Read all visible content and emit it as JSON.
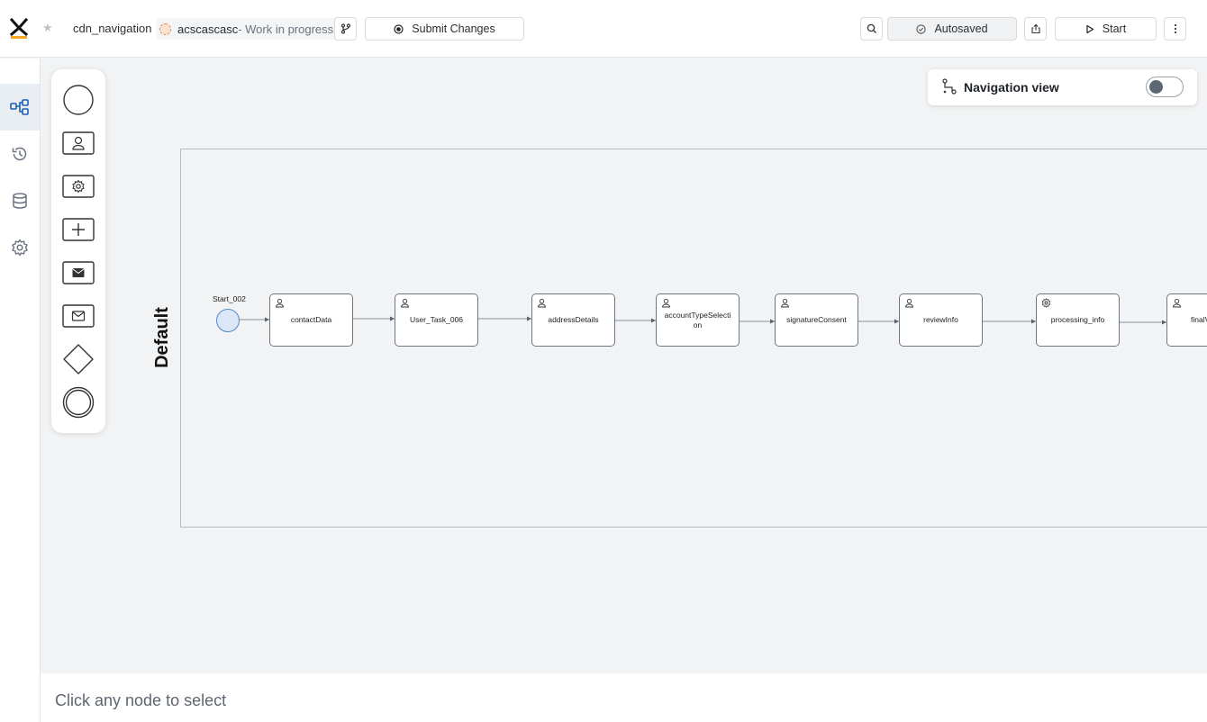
{
  "header": {
    "project_name": "cdn_navigation",
    "branch_name": "acscascasc",
    "branch_status": "- Work in progress",
    "submit_label": "Submit Changes",
    "autosave_label": "Autosaved",
    "start_label": "Start"
  },
  "navigation_view": {
    "title": "Navigation view",
    "enabled": false
  },
  "pool": {
    "label": "Default"
  },
  "start_event": {
    "label": "Start_002"
  },
  "tasks": [
    {
      "label": "contactData",
      "type": "user"
    },
    {
      "label": "User_Task_006",
      "type": "user"
    },
    {
      "label": "addressDetails",
      "type": "user"
    },
    {
      "label": "accountTypeSelection",
      "type": "user"
    },
    {
      "label": "signatureConsent",
      "type": "user"
    },
    {
      "label": "reviewInfo",
      "type": "user"
    },
    {
      "label": "processing_info",
      "type": "service"
    },
    {
      "label": "finalV",
      "type": "user"
    }
  ],
  "footer": {
    "hint": "Click any node to select"
  },
  "colors": {
    "accent": "#1f5fb3",
    "logo_orange": "#f5a623"
  }
}
